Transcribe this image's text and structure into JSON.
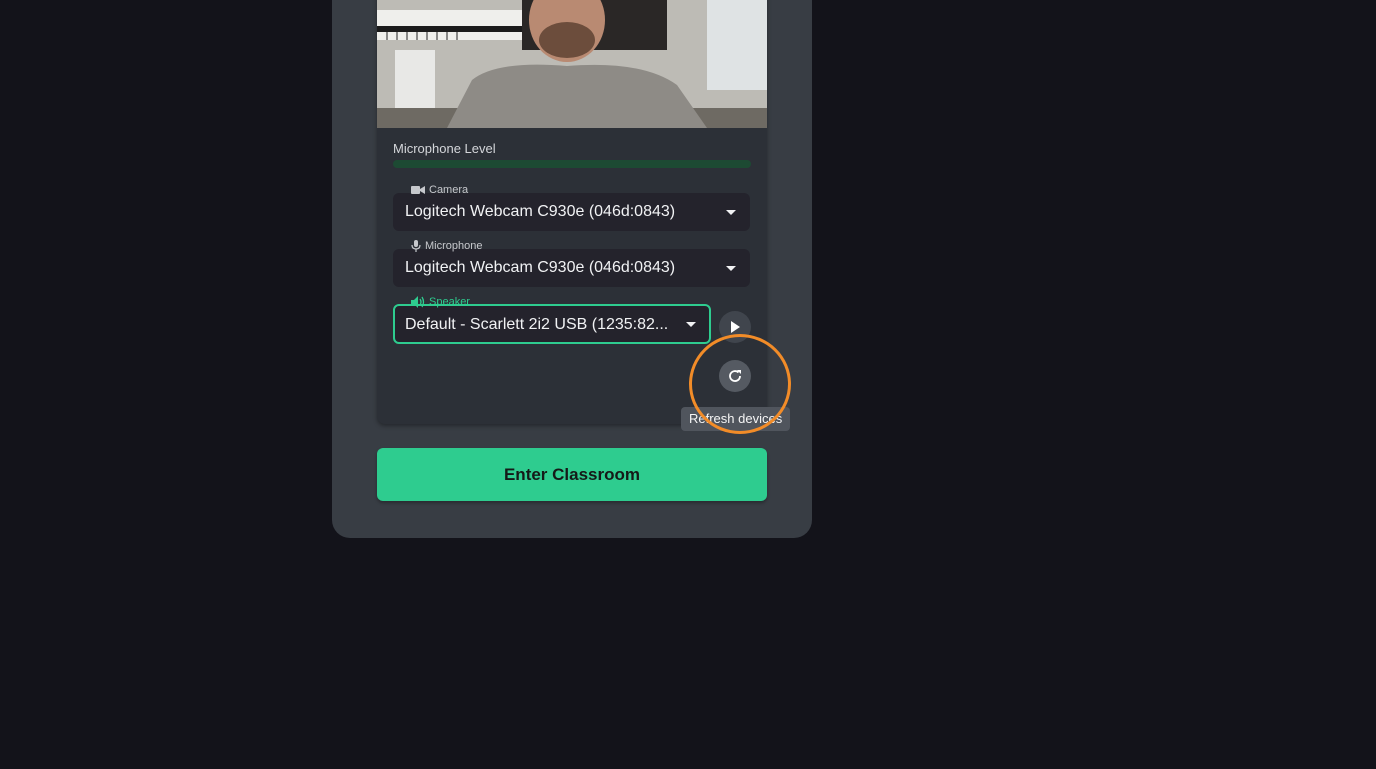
{
  "preview": {
    "microphone_level_label": "Microphone Level",
    "microphone_level": 0.0
  },
  "devices": {
    "camera": {
      "label": "Camera",
      "value": "Logitech Webcam C930e (046d:0843)",
      "icon": "video-camera-icon"
    },
    "microphone": {
      "label": "Microphone",
      "value": "Logitech Webcam C930e (046d:0843)",
      "icon": "microphone-icon"
    },
    "speaker": {
      "label": "Speaker",
      "value": "Default - Scarlett 2i2 USB (1235:82...",
      "icon": "speaker-icon"
    }
  },
  "actions": {
    "play_icon": "play-icon",
    "refresh_icon": "refresh-icon",
    "refresh_tooltip": "Refresh devices",
    "enter_label": "Enter Classroom"
  },
  "colors": {
    "accent": "#2ecc8f",
    "highlight_ring": "#f28c28",
    "background": "#13131a"
  }
}
